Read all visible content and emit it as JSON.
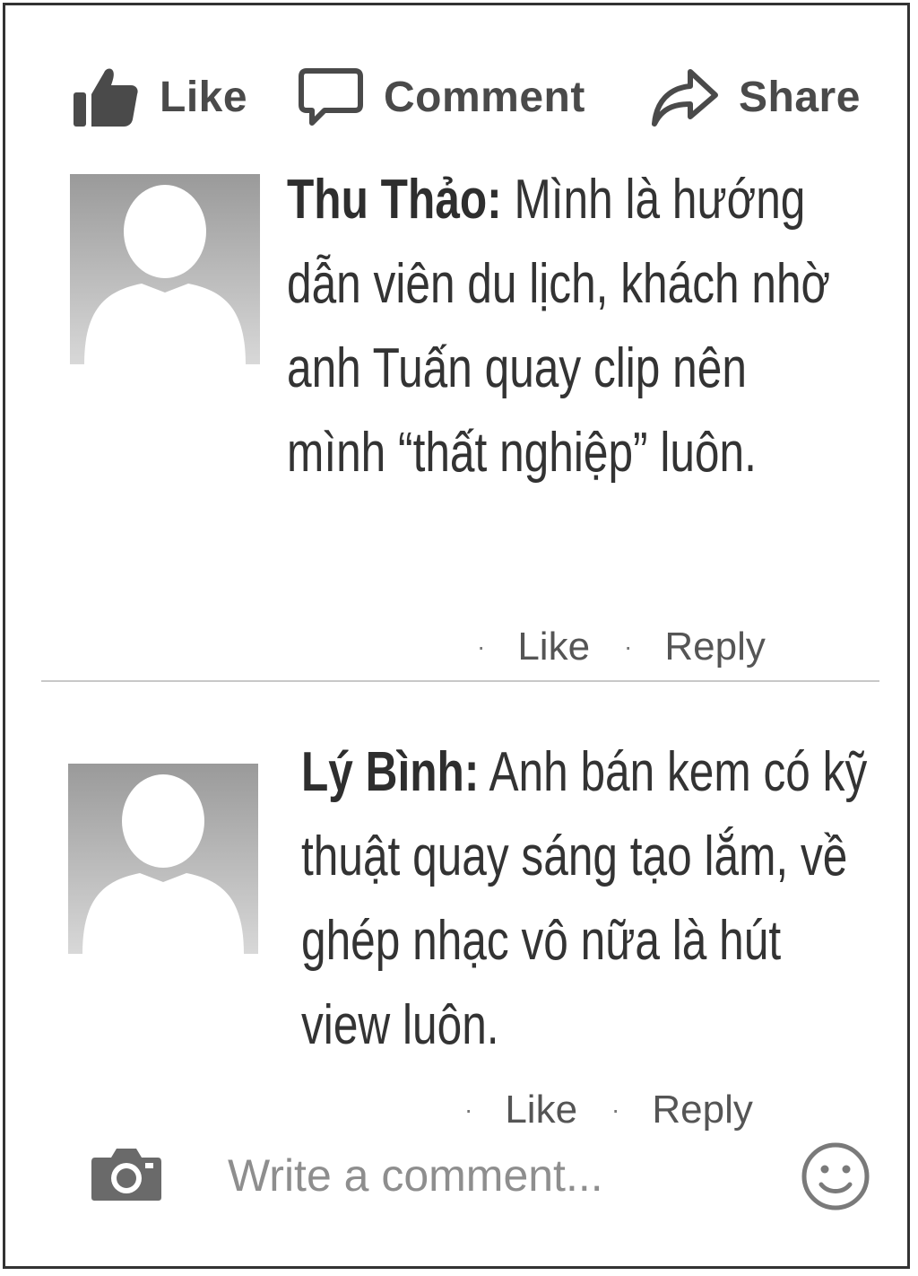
{
  "actions": {
    "like": {
      "label": "Like",
      "icon": "thumbs-up-icon"
    },
    "comment": {
      "label": "Comment",
      "icon": "speech-bubble-icon"
    },
    "share": {
      "label": "Share",
      "icon": "share-arrow-icon"
    }
  },
  "comments": [
    {
      "author": "Thu Thảo:",
      "text": "Mình là hướng dẫn viên du lịch, khách nhờ anh Tuấn quay clip nên mình “thất nghiệp” luôn.",
      "like_label": "Like",
      "reply_label": "Reply",
      "separator": "·"
    },
    {
      "author": "Lý Bình:",
      "text": "Anh bán kem có kỹ thuật quay sáng tạo lắm, về ghép nhạc vô nữa là hút view luôn.",
      "like_label": "Like",
      "reply_label": "Reply",
      "separator": "·"
    }
  ],
  "composer": {
    "placeholder": "Write a comment...",
    "camera_icon": "camera-icon",
    "emoji_icon": "smiley-icon"
  },
  "colors": {
    "icon_gray": "#4a4a4a",
    "text": "#333333",
    "muted": "#8e8e8e",
    "divider": "#c8c8c8",
    "avatar_bg_top": "#8c8c8c",
    "avatar_bg_bottom": "#d6d6d6"
  }
}
